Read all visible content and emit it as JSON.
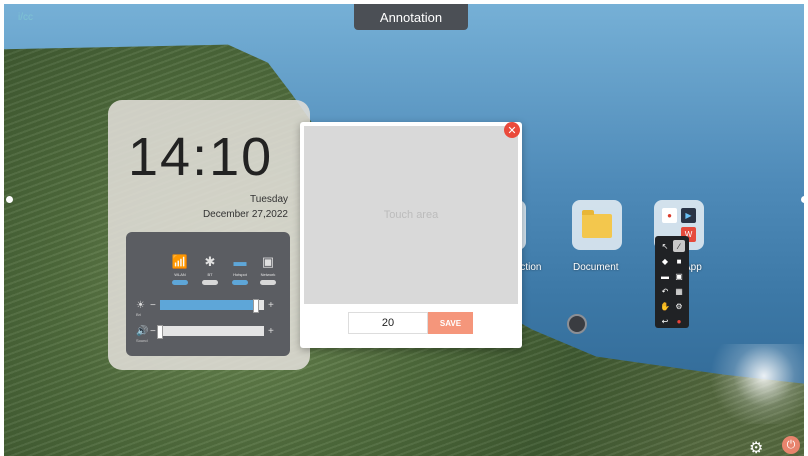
{
  "topbar": {
    "logo_text": "i/cc",
    "annotation_tab": "Annotation"
  },
  "clock": {
    "time": "14:10",
    "weekday": "Tuesday",
    "date": "December 27,2022"
  },
  "control_panel": {
    "connections": [
      {
        "icon": "wifi-icon",
        "label": "WLAN",
        "enabled": true
      },
      {
        "icon": "bluetooth-icon",
        "label": "BT",
        "enabled": false
      },
      {
        "icon": "hotspot-icon",
        "label": "Hotspot",
        "enabled": true
      },
      {
        "icon": "network-icon",
        "label": "Network",
        "enabled": false
      }
    ],
    "brightness": {
      "label": "Bri",
      "level": 0.92
    },
    "sound": {
      "label": "Sound",
      "level": 0.0
    }
  },
  "annotation_dialog": {
    "touch_area_label": "Touch area",
    "value": "20",
    "save_label": "SAVE"
  },
  "apps": [
    {
      "icon": "projection-icon",
      "label": "...ction"
    },
    {
      "icon": "folder-icon",
      "label": "Document"
    },
    {
      "icon": "apps-folder-icon",
      "label": "App"
    }
  ],
  "colors": {
    "accent": "#5ea6d8",
    "save": "#f5967b",
    "close": "#ea4a3b",
    "tab_bg": "#4b4f55"
  }
}
